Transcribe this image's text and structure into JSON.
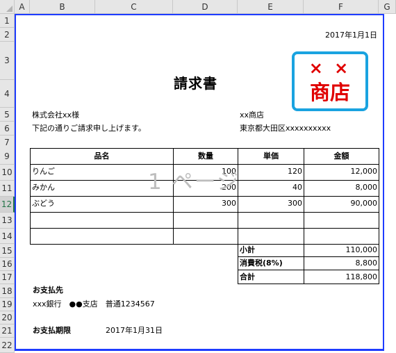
{
  "sheet": {
    "columns": [
      "A",
      "B",
      "C",
      "D",
      "E",
      "F",
      "G"
    ],
    "rows": [
      "1",
      "2",
      "3",
      "4",
      "5",
      "6",
      "7",
      "8",
      "9",
      "10",
      "11",
      "12",
      "13",
      "14",
      "15",
      "16",
      "17",
      "18",
      "19",
      "20",
      "21",
      "22"
    ],
    "selected_row": "12"
  },
  "invoice": {
    "date": "2017年1月1日",
    "title": "請求書",
    "customer": "株式会社xx様",
    "intro": "下記の通りご請求申し上げます。",
    "seller_name": "xx商店",
    "seller_address": "東京都大田区xxxxxxxxxx",
    "logo": {
      "top": "× ×",
      "bottom": "商店",
      "border_color": "#1aa3e0",
      "text_color": "#e00000"
    },
    "headers": [
      "品名",
      "数量",
      "単価",
      "金額"
    ],
    "items": [
      {
        "name": "りんご",
        "qty": "100",
        "price": "120",
        "amount": "12,000"
      },
      {
        "name": "みかん",
        "qty": "200",
        "price": "40",
        "amount": "8,000"
      },
      {
        "name": "ぶどう",
        "qty": "300",
        "price": "300",
        "amount": "90,000"
      },
      {
        "name": "",
        "qty": "",
        "price": "",
        "amount": ""
      },
      {
        "name": "",
        "qty": "",
        "price": "",
        "amount": ""
      }
    ],
    "subtotal_label": "小計",
    "subtotal": "110,000",
    "tax_label": "消費税(8%)",
    "tax": "8,800",
    "total_label": "合計",
    "total": "118,800",
    "payee_label": "お支払先",
    "payee": "xxx銀行　●●支店　普通1234567",
    "due_label": "お支払期限",
    "due": "2017年1月31日"
  },
  "watermark": "1 ページ"
}
